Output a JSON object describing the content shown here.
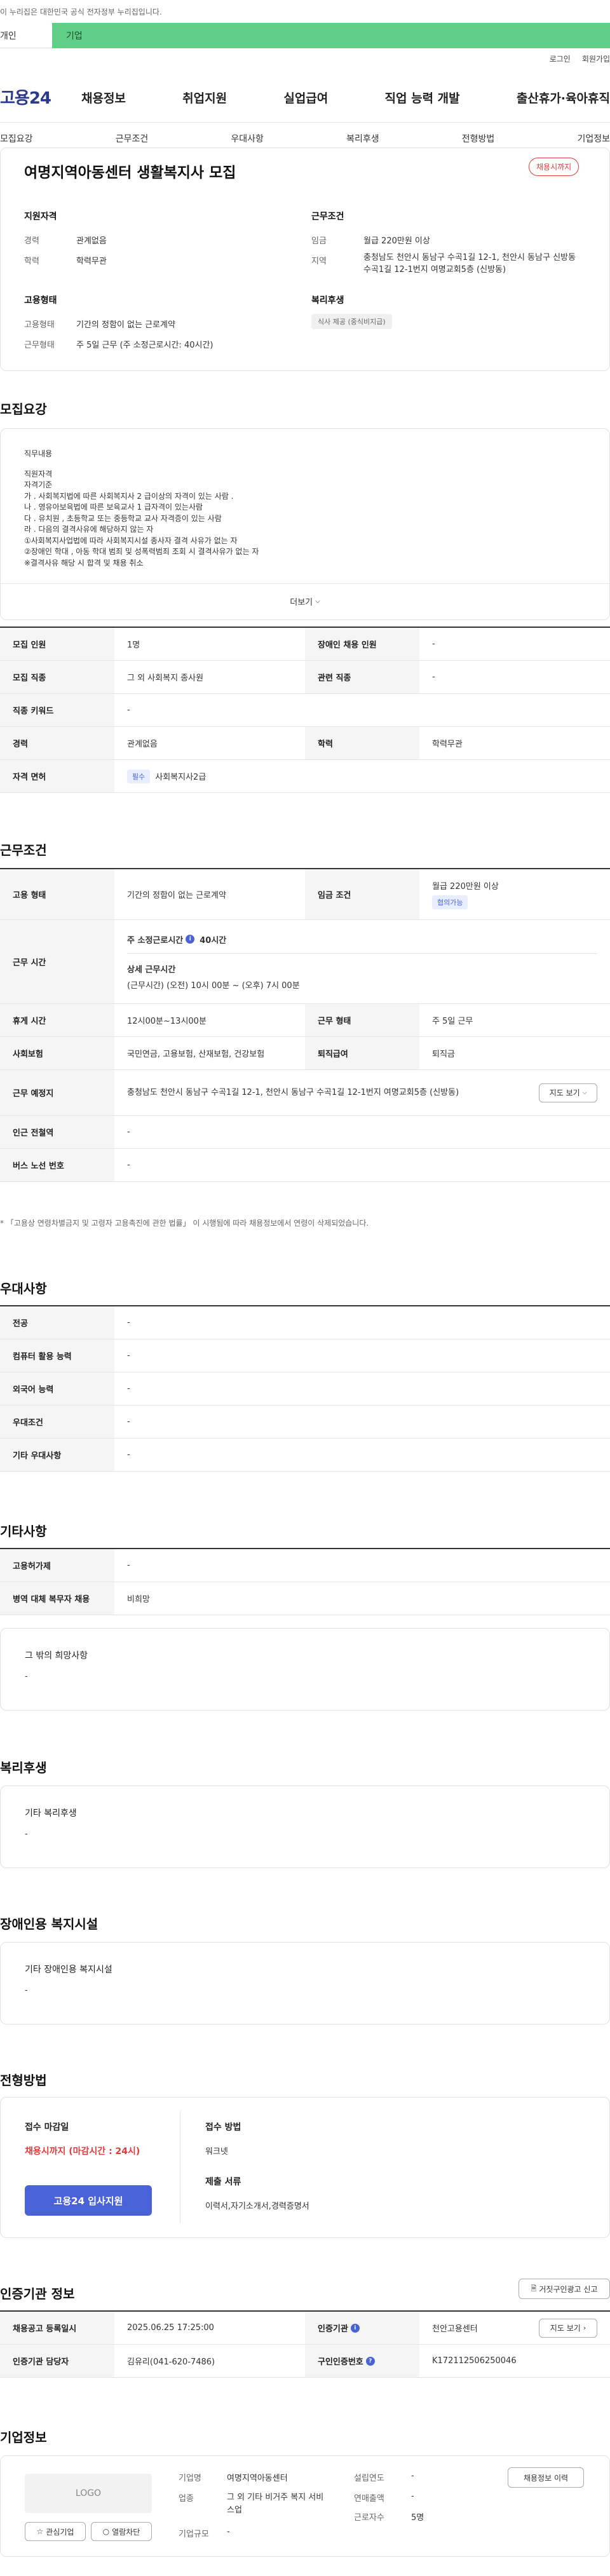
{
  "gov_banner": "이 누리집은 대한민국 공식 전자정부 누리집입니다.",
  "portal": {
    "personal": "개인",
    "corporate": "기업"
  },
  "util": {
    "login": "로그인",
    "signup": "회원가입"
  },
  "logo": "고용24",
  "gnb": [
    "채용정보",
    "취업지원",
    "실업급여",
    "직업 능력 개발",
    "출산휴가·육아휴직"
  ],
  "subnav": [
    "모집요강",
    "근무조건",
    "우대사항",
    "복리후생",
    "전형방법",
    "기업정보"
  ],
  "summary": {
    "title": "여명지역아동센터 생활복지사 모집",
    "status_badge": "채용시까지",
    "qualification_title": "지원자격",
    "career_label": "경력",
    "career_value": "관계없음",
    "education_label": "학력",
    "education_value": "학력무관",
    "work_cond_title": "근무조건",
    "wage_label": "임금",
    "wage_value": "월급 220만원 이상",
    "region_label": "지역",
    "region_value": "충청남도 천안시 동남구 수곡1길 12-1, 천안시 동남구 신방동 수곡1길 12-1번지 여명교회5층 (신방동)",
    "employ_title": "고용형태",
    "employ_type_label": "고용형태",
    "employ_type_value": "기간의 정함이 없는 근로계약",
    "work_form_label": "근무형태",
    "work_form_value": "주 5일 근무 (주 소정근로시간: 40시간)",
    "welfare_title": "복리후생",
    "welfare_chip": "식사 제공 (중식비지급)"
  },
  "recruit": {
    "section_title": "모집요강",
    "duty_title": "직무내용",
    "duty_lines": [
      "직원자격",
      "자격기준",
      "가 . 사회복지법에 따른 사회복지사  2 급이상의 자격이 있는 사람 .",
      "나 . 영유아보육법에 따른 보육교사  1 급자격이 있는사람",
      "다 . 유치원 , 초등학교 또는 중등학교 교사 자격증이 있는 사람",
      "라 . 다음의 결격사유에 해당하지 않는 자",
      "①사회복지사업법에 따라 사회복지시설 종사자 결격 사유가 없는 자",
      "②장애인 학대 , 아동 학대 범죄 및 성폭력범죄 조회 시 결격사유가 없는 자",
      "※결격사유 해당 시 합격 및 채용 취소"
    ],
    "more_label": "더보기",
    "rows": [
      {
        "l1": "모집 인원",
        "v1": "1명",
        "l2": "장애인 채용 인원",
        "v2": "-"
      },
      {
        "l1": "모집 직종",
        "v1": "그 외 사회복지 종사원",
        "l2": "관련 직종",
        "v2": "-"
      },
      {
        "l1": "직종 키워드",
        "v1": "-"
      },
      {
        "l1": "경력",
        "v1": "관계없음",
        "l2": "학력",
        "v2": "학력무관"
      },
      {
        "l1": "자격 면허",
        "chip": "필수",
        "v1": "사회복지사2급"
      }
    ]
  },
  "workcond": {
    "section_title": "근무조건",
    "employ_label": "고용 형태",
    "employ_value": "기간의 정함이 없는 근로계약",
    "wage_label": "임금 조건",
    "wage_value": "월급 220만원 이상",
    "wage_chip": "협의가능",
    "hours_label": "근무 시간",
    "hours_weekly_label": "주 소정근로시간",
    "hours_weekly_value": "40시간",
    "hours_detail_title": "상세 근무시간",
    "hours_detail_value": "(근무시간) (오전) 10시 00분 ~ (오후) 7시 00분",
    "break_label": "휴게 시간",
    "break_value": "12시00분~13시00분",
    "workform_label": "근무 형태",
    "workform_value": "주 5일 근무",
    "insurance_label": "사회보험",
    "insurance_value": "국민연금, 고용보험, 산재보험, 건강보험",
    "retire_label": "퇴직급여",
    "retire_value": "퇴직금",
    "place_label": "근무 예정지",
    "place_value": "충청남도 천안시 동남구 수곡1길 12-1, 천안시 동남구 수곡1길 12-1번지 여명교회5층 (신방동)",
    "map_label": "지도 보기",
    "subway_label": "인근 전철역",
    "subway_value": "-",
    "bus_label": "버스 노선 번호",
    "bus_value": "-",
    "note": "* 「고용상 연령차별금지 및 고령자 고용촉진에 관한 법률」 이 시행됨에 따라 채용정보에서 연령이 삭제되었습니다."
  },
  "prefer": {
    "section_title": "우대사항",
    "rows": [
      {
        "l": "전공",
        "v": "-"
      },
      {
        "l": "컴퓨터 활용 능력",
        "v": "-"
      },
      {
        "l": "외국어 능력",
        "v": "-"
      },
      {
        "l": "우대조건",
        "v": "-"
      },
      {
        "l": "기타 우대사항",
        "v": "-"
      }
    ]
  },
  "etc": {
    "section_title": "기타사항",
    "rows": [
      {
        "l": "고용허가제",
        "v": "-"
      },
      {
        "l": "병역 대체 복무자 채용",
        "v": "비희망"
      }
    ],
    "other_title": "그 밖의 희망사항",
    "other_value": "-"
  },
  "welfare": {
    "section_title": "복리후생",
    "box_title": "기타 복리후생",
    "box_value": "-"
  },
  "disability": {
    "section_title": "장애인용 복지시설",
    "box_title": "기타 장애인용 복지시설",
    "box_value": "-"
  },
  "process": {
    "section_title": "전형방법",
    "deadline_label": "접수 마감일",
    "deadline_value": "채용시까지 (마감시간 : 24시)",
    "apply_button": "고용24 입사지원",
    "method_label": "접수 방법",
    "method_value": "워크넷",
    "docs_label": "제출 서류",
    "docs_value": "이력서,자기소개서,경력증명서"
  },
  "cert": {
    "section_title": "인증기관 정보",
    "report_button": "거짓구인광고 신고",
    "reg_date_label": "채용공고 등록일시",
    "reg_date_value": "2025.06.25 17:25:00",
    "org_label": "인증기관",
    "org_value": "천안고용센터",
    "map_button": "지도 보기",
    "manager_label": "인증기관 담당자",
    "manager_value": "김유리(041-620-7486)",
    "cert_no_label": "구인인증번호",
    "cert_no_value": "K172112506250046"
  },
  "company": {
    "section_title": "기업정보",
    "logo_placeholder": "LOGO",
    "fav_button": "관심기업",
    "block_button": "열람차단",
    "name_label": "기업명",
    "name_value": "여명지역아동센터",
    "industry_label": "업종",
    "industry_value": "그 외 기타 비거주 복지 서비스업",
    "size_label": "기업규모",
    "size_value": "-",
    "founded_label": "설립연도",
    "founded_value": "-",
    "revenue_label": "연매출액",
    "revenue_value": "-",
    "employees_label": "근로자수",
    "employees_value": "5명",
    "jobs_button": "채용정보 이력"
  }
}
